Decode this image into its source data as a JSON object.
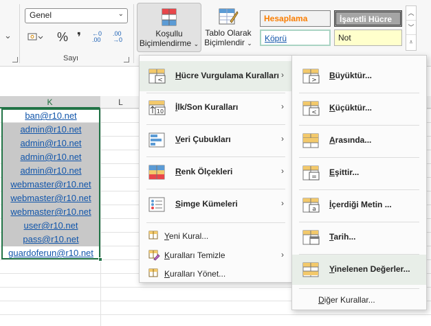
{
  "ribbon": {
    "number_format_value": "Genel",
    "number_group_label": "Sayı",
    "conditional_formatting_label_1": "Koşullu",
    "conditional_formatting_label_2": "Biçimlendirme",
    "table_format_label_1": "Tablo Olarak",
    "table_format_label_2": "Biçimlendir",
    "styles": {
      "calculation": "Hesaplama",
      "check_cell": "İşaretli Hücre",
      "hyperlink": "Köprü",
      "note": "Not"
    },
    "percent_symbol": "%",
    "comma_symbol": "❜",
    "inc_decimal": "←0 .00",
    "dec_decimal": ".00 →0"
  },
  "sheet": {
    "columns": [
      "K",
      "L"
    ],
    "cells": [
      {
        "text": "ban@r10.net",
        "dup": false
      },
      {
        "text": "admin@r10.net",
        "dup": true
      },
      {
        "text": "admin@r10.net",
        "dup": true
      },
      {
        "text": "admin@r10.net",
        "dup": true
      },
      {
        "text": "admin@r10.net",
        "dup": true
      },
      {
        "text": "webmaster@r10.net",
        "dup": true
      },
      {
        "text": "webmaster@r10.net",
        "dup": true
      },
      {
        "text": "webmaster@r10.net",
        "dup": true
      },
      {
        "text": "user@r10.net",
        "dup": true
      },
      {
        "text": "pass@r10.net",
        "dup": true
      },
      {
        "text": "guardoferun@r10.net",
        "dup": false
      }
    ]
  },
  "main_menu": {
    "items": [
      {
        "label": "Hücre Vurgulama Kuralları",
        "u": "H",
        "rest": "ücre Vurgulama Kuralları",
        "icon": "highlight-cells-icon",
        "has_sub": true
      },
      {
        "label": "İlk/Son Kuralları",
        "u": "İ",
        "rest": "lk/Son Kuralları",
        "icon": "top-bottom-icon",
        "has_sub": true
      },
      {
        "label": "Veri Çubukları",
        "u": "V",
        "rest": "eri Çubukları",
        "icon": "data-bars-icon",
        "has_sub": true
      },
      {
        "label": "Renk Ölçekleri",
        "u": "R",
        "rest": "enk Ölçekleri",
        "icon": "color-scales-icon",
        "has_sub": true
      },
      {
        "label": "Simge Kümeleri",
        "u": "S",
        "rest": "imge Kümeleri",
        "icon": "icon-sets-icon",
        "has_sub": true
      }
    ],
    "small_items": [
      {
        "u": "Y",
        "rest": "eni Kural...",
        "icon": "new-rule-icon",
        "has_sub": false
      },
      {
        "u": "K",
        "rest": "uralları Temizle",
        "icon": "clear-rules-icon",
        "has_sub": true
      },
      {
        "u": "K",
        "rest": "uralları Yönet...",
        "icon": "manage-rules-icon",
        "has_sub": false
      }
    ]
  },
  "sub_menu": {
    "items": [
      {
        "u": "B",
        "rest": "üyüktür...",
        "icon": "greater-than-icon",
        "glyph": ">"
      },
      {
        "u": "K",
        "rest": "üçüktür...",
        "icon": "less-than-icon",
        "glyph": "<"
      },
      {
        "u": "A",
        "rest": "rasında...",
        "icon": "between-icon",
        "glyph": ""
      },
      {
        "u": "E",
        "rest": "şittir...",
        "icon": "equal-to-icon",
        "glyph": "="
      },
      {
        "u": "İ",
        "rest": "çerdiği Metin ...",
        "icon": "text-contains-icon",
        "glyph": "a"
      },
      {
        "u": "T",
        "rest": "arih...",
        "icon": "date-occurring-icon",
        "glyph": ""
      },
      {
        "u": "Y",
        "rest": "inelenen Değerler...",
        "icon": "duplicate-values-icon",
        "glyph": ""
      }
    ],
    "more_rules_u": "D",
    "more_rules_rest": "iğer Kurallar..."
  },
  "colors": {
    "accent_green": "#217346",
    "hyperlink_blue": "#1155aa",
    "duplicate_fill": "#c8c8c8",
    "calc_orange": "#fa7d00",
    "note_fill": "#ffffcc"
  }
}
